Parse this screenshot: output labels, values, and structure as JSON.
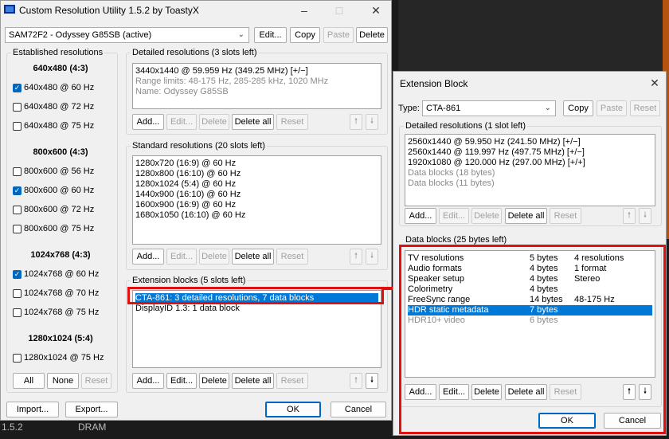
{
  "main": {
    "title": "Custom Resolution Utility 1.5.2 by ToastyX",
    "monitor": "SAM72F2 - Odyssey G85SB (active)",
    "top_buttons": {
      "edit": "Edit...",
      "copy": "Copy",
      "paste": "Paste",
      "delete": "Delete"
    },
    "established": {
      "title": "Established resolutions",
      "groups": [
        {
          "header": "640x480 (4:3)",
          "items": [
            {
              "label": "640x480 @ 60 Hz",
              "checked": true
            },
            {
              "label": "640x480 @ 72 Hz",
              "checked": false
            },
            {
              "label": "640x480 @ 75 Hz",
              "checked": false
            }
          ]
        },
        {
          "header": "800x600 (4:3)",
          "items": [
            {
              "label": "800x600 @ 56 Hz",
              "checked": false
            },
            {
              "label": "800x600 @ 60 Hz",
              "checked": true
            },
            {
              "label": "800x600 @ 72 Hz",
              "checked": false
            },
            {
              "label": "800x600 @ 75 Hz",
              "checked": false
            }
          ]
        },
        {
          "header": "1024x768 (4:3)",
          "items": [
            {
              "label": "1024x768 @ 60 Hz",
              "checked": true
            },
            {
              "label": "1024x768 @ 70 Hz",
              "checked": false
            },
            {
              "label": "1024x768 @ 75 Hz",
              "checked": false
            }
          ]
        },
        {
          "header": "1280x1024 (5:4)",
          "items": [
            {
              "label": "1280x1024 @ 75 Hz",
              "checked": false
            }
          ]
        }
      ],
      "buttons": {
        "all": "All",
        "none": "None",
        "reset": "Reset"
      }
    },
    "detailed": {
      "title": "Detailed resolutions (3 slots left)",
      "lines": [
        "3440x1440 @ 59.959 Hz (349.25 MHz) [+/−]",
        "Range limits: 48-175 Hz, 285-285 kHz, 1020 MHz",
        "Name: Odyssey G85SB"
      ]
    },
    "standard": {
      "title": "Standard resolutions (20 slots left)",
      "lines": [
        "1280x720 (16:9) @ 60 Hz",
        "1280x800 (16:10) @ 60 Hz",
        "1280x1024 (5:4) @ 60 Hz",
        "1440x900 (16:10) @ 60 Hz",
        "1600x900 (16:9) @ 60 Hz",
        "1680x1050 (16:10) @ 60 Hz"
      ]
    },
    "extension": {
      "title": "Extension blocks (5 slots left)",
      "lines": [
        "CTA-861: 3 detailed resolutions, 7 data blocks",
        "DisplayID 1.3: 1 data block"
      ]
    },
    "list_buttons": {
      "add": "Add...",
      "edit": "Edit...",
      "delete": "Delete",
      "delete_all": "Delete all",
      "reset": "Reset"
    },
    "bottom": {
      "import": "Import...",
      "export": "Export...",
      "ok": "OK",
      "cancel": "Cancel"
    }
  },
  "ext_dialog": {
    "title": "Extension Block",
    "type_label": "Type:",
    "type_value": "CTA-861",
    "buttons": {
      "copy": "Copy",
      "paste": "Paste",
      "reset": "Reset"
    },
    "detailed": {
      "title": "Detailed resolutions (1 slot left)",
      "lines": [
        {
          "text": "2560x1440 @ 59.950 Hz (241.50 MHz) [+/−]",
          "gray": false
        },
        {
          "text": "2560x1440 @ 119.997 Hz (497.75 MHz) [+/−]",
          "gray": false
        },
        {
          "text": "1920x1080 @ 120.000 Hz (297.00 MHz) [+/+]",
          "gray": false
        },
        {
          "text": "Data blocks (18 bytes)",
          "gray": true
        },
        {
          "text": "Data blocks (11 bytes)",
          "gray": true
        }
      ]
    },
    "datablocks": {
      "title": "Data blocks (25 bytes left)",
      "rows": [
        {
          "name": "TV resolutions",
          "size": "5 bytes",
          "info": "4 resolutions",
          "selected": false,
          "gray": false
        },
        {
          "name": "Audio formats",
          "size": "4 bytes",
          "info": "1 format",
          "selected": false,
          "gray": false
        },
        {
          "name": "Speaker setup",
          "size": "4 bytes",
          "info": "Stereo",
          "selected": false,
          "gray": false
        },
        {
          "name": "Colorimetry",
          "size": "4 bytes",
          "info": "",
          "selected": false,
          "gray": false
        },
        {
          "name": "FreeSync range",
          "size": "14 bytes",
          "info": "48-175 Hz",
          "selected": false,
          "gray": false
        },
        {
          "name": "HDR static metadata",
          "size": "7 bytes",
          "info": "",
          "selected": true,
          "gray": false
        },
        {
          "name": "HDR10+ video",
          "size": "6 bytes",
          "info": "",
          "selected": false,
          "gray": true
        }
      ]
    },
    "list_buttons": {
      "add": "Add...",
      "edit": "Edit...",
      "delete": "Delete",
      "delete_all": "Delete all",
      "reset": "Reset"
    },
    "bottom": {
      "ok": "OK",
      "cancel": "Cancel"
    }
  },
  "background": {
    "version": "1.5.2",
    "dram": "DRAM"
  },
  "colors": {
    "annotation": "#e01010",
    "selection": "#0078d7",
    "accent": "#0067c0"
  }
}
